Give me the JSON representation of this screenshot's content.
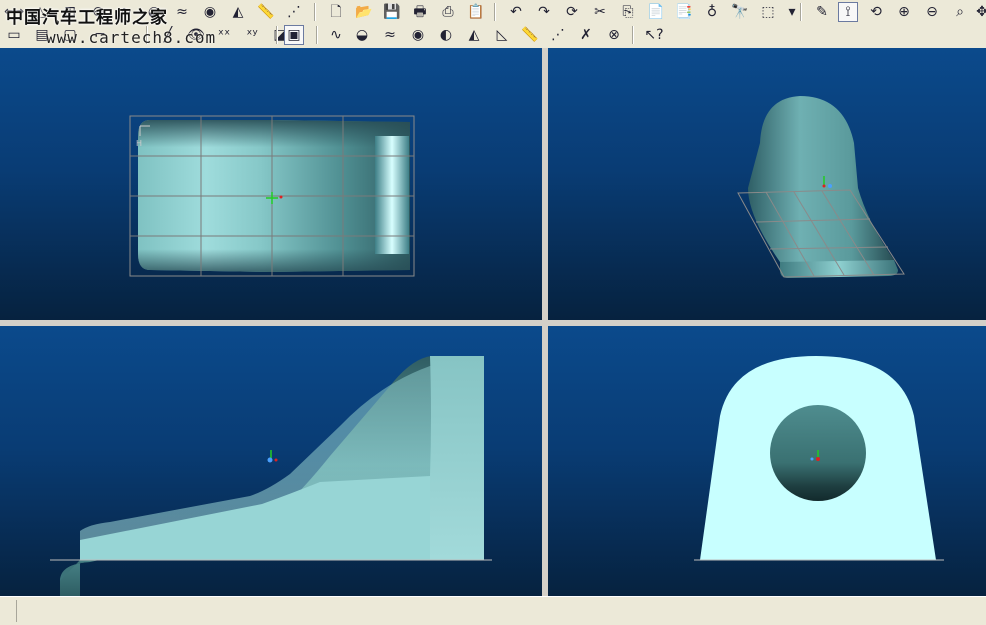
{
  "watermark": {
    "line1": "中国汽车工程师之家",
    "line2": "www.cartech8.com"
  },
  "toolbar_row1": [
    {
      "icon": "fit-all-icon",
      "glyph": "⟺"
    },
    {
      "icon": "triangle-icon",
      "glyph": "△"
    },
    {
      "icon": "grid-icon",
      "glyph": "⊞"
    },
    {
      "icon": "section-icon",
      "glyph": "⊖"
    },
    {
      "icon": "curve-icon",
      "glyph": "∿"
    },
    {
      "icon": "surface-icon",
      "glyph": "◒"
    },
    {
      "icon": "wave-icon",
      "glyph": "≈"
    },
    {
      "icon": "color-map-icon",
      "glyph": "◉"
    },
    {
      "icon": "draft-analysis-icon",
      "glyph": "◭"
    },
    {
      "icon": "ruler-icon",
      "glyph": "📏"
    },
    {
      "icon": "porcupine-icon",
      "glyph": "⋰"
    },
    {
      "icon": "new-file-icon",
      "glyph": "🗋"
    },
    {
      "icon": "open-file-icon",
      "glyph": "📂"
    },
    {
      "icon": "save-icon",
      "glyph": "💾"
    },
    {
      "icon": "print-icon",
      "glyph": "🖶"
    },
    {
      "icon": "print-preview-icon",
      "glyph": "⎙"
    },
    {
      "icon": "clipboard-icon",
      "glyph": "📋"
    },
    {
      "icon": "undo-icon",
      "glyph": "↶"
    },
    {
      "icon": "redo-icon",
      "glyph": "↷"
    },
    {
      "icon": "refresh-icon",
      "glyph": "⟳"
    },
    {
      "icon": "cut-icon",
      "glyph": "✂"
    },
    {
      "icon": "copy-icon",
      "glyph": "⎘"
    },
    {
      "icon": "paste-icon",
      "glyph": "📄"
    },
    {
      "icon": "paste-special-icon",
      "glyph": "📑"
    },
    {
      "icon": "light-icon",
      "glyph": "♁"
    },
    {
      "icon": "binoculars-icon",
      "glyph": "🔭"
    },
    {
      "icon": "selection-box-icon",
      "glyph": "⬚"
    },
    {
      "icon": "dropdown-arrow-icon",
      "glyph": "▾"
    },
    {
      "icon": "sketch-icon",
      "glyph": "✎"
    },
    {
      "icon": "connect-icon",
      "glyph": "⟟"
    },
    {
      "icon": "rotate-view-icon",
      "glyph": "⟲"
    },
    {
      "icon": "zoom-in-icon",
      "glyph": "⊕"
    },
    {
      "icon": "zoom-out-icon",
      "glyph": "⊖"
    },
    {
      "icon": "zoom-window-icon",
      "glyph": "⌕"
    },
    {
      "icon": "pan-icon",
      "glyph": "✥"
    }
  ],
  "toolbar_row2": [
    {
      "icon": "model-tree-icon",
      "glyph": "▭"
    },
    {
      "icon": "layer-icon",
      "glyph": "▤"
    },
    {
      "icon": "box-icon",
      "glyph": "▢"
    },
    {
      "icon": "dimension-icon",
      "glyph": "⌐"
    },
    {
      "icon": "line-icon",
      "glyph": "╱"
    },
    {
      "icon": "eye-icon",
      "glyph": "👁"
    },
    {
      "icon": "points-xx-icon",
      "glyph": "ˣˣ"
    },
    {
      "icon": "points-xy-icon",
      "glyph": "ˣʸ"
    },
    {
      "icon": "shape-eye-icon",
      "glyph": "◪"
    },
    {
      "icon": "view-frame-icon",
      "glyph": "▣"
    },
    {
      "icon": "curve-analysis-icon",
      "glyph": "∿"
    },
    {
      "icon": "surface-analysis-icon",
      "glyph": "◒"
    },
    {
      "icon": "curvature-icon",
      "glyph": "≈"
    },
    {
      "icon": "gaussian-icon",
      "glyph": "◉"
    },
    {
      "icon": "deviation-icon",
      "glyph": "◐"
    },
    {
      "icon": "draft-icon",
      "glyph": "◭"
    },
    {
      "icon": "slope-icon",
      "glyph": "◺"
    },
    {
      "icon": "measure-icon",
      "glyph": "📏"
    },
    {
      "icon": "porcupine-delete-icon",
      "glyph": "⋰"
    },
    {
      "icon": "curve-delete-icon",
      "glyph": "✗"
    },
    {
      "icon": "surface-delete-icon",
      "glyph": "⊗"
    },
    {
      "icon": "whats-this-icon",
      "glyph": "↖?"
    }
  ],
  "status": {
    "text": ""
  },
  "colors": {
    "viewport_top": "#0b4a8c",
    "viewport_bottom": "#06223f",
    "part_fill": "#8fcfcf",
    "part_light": "#c8ffff",
    "ui_face": "#ece9d8"
  }
}
